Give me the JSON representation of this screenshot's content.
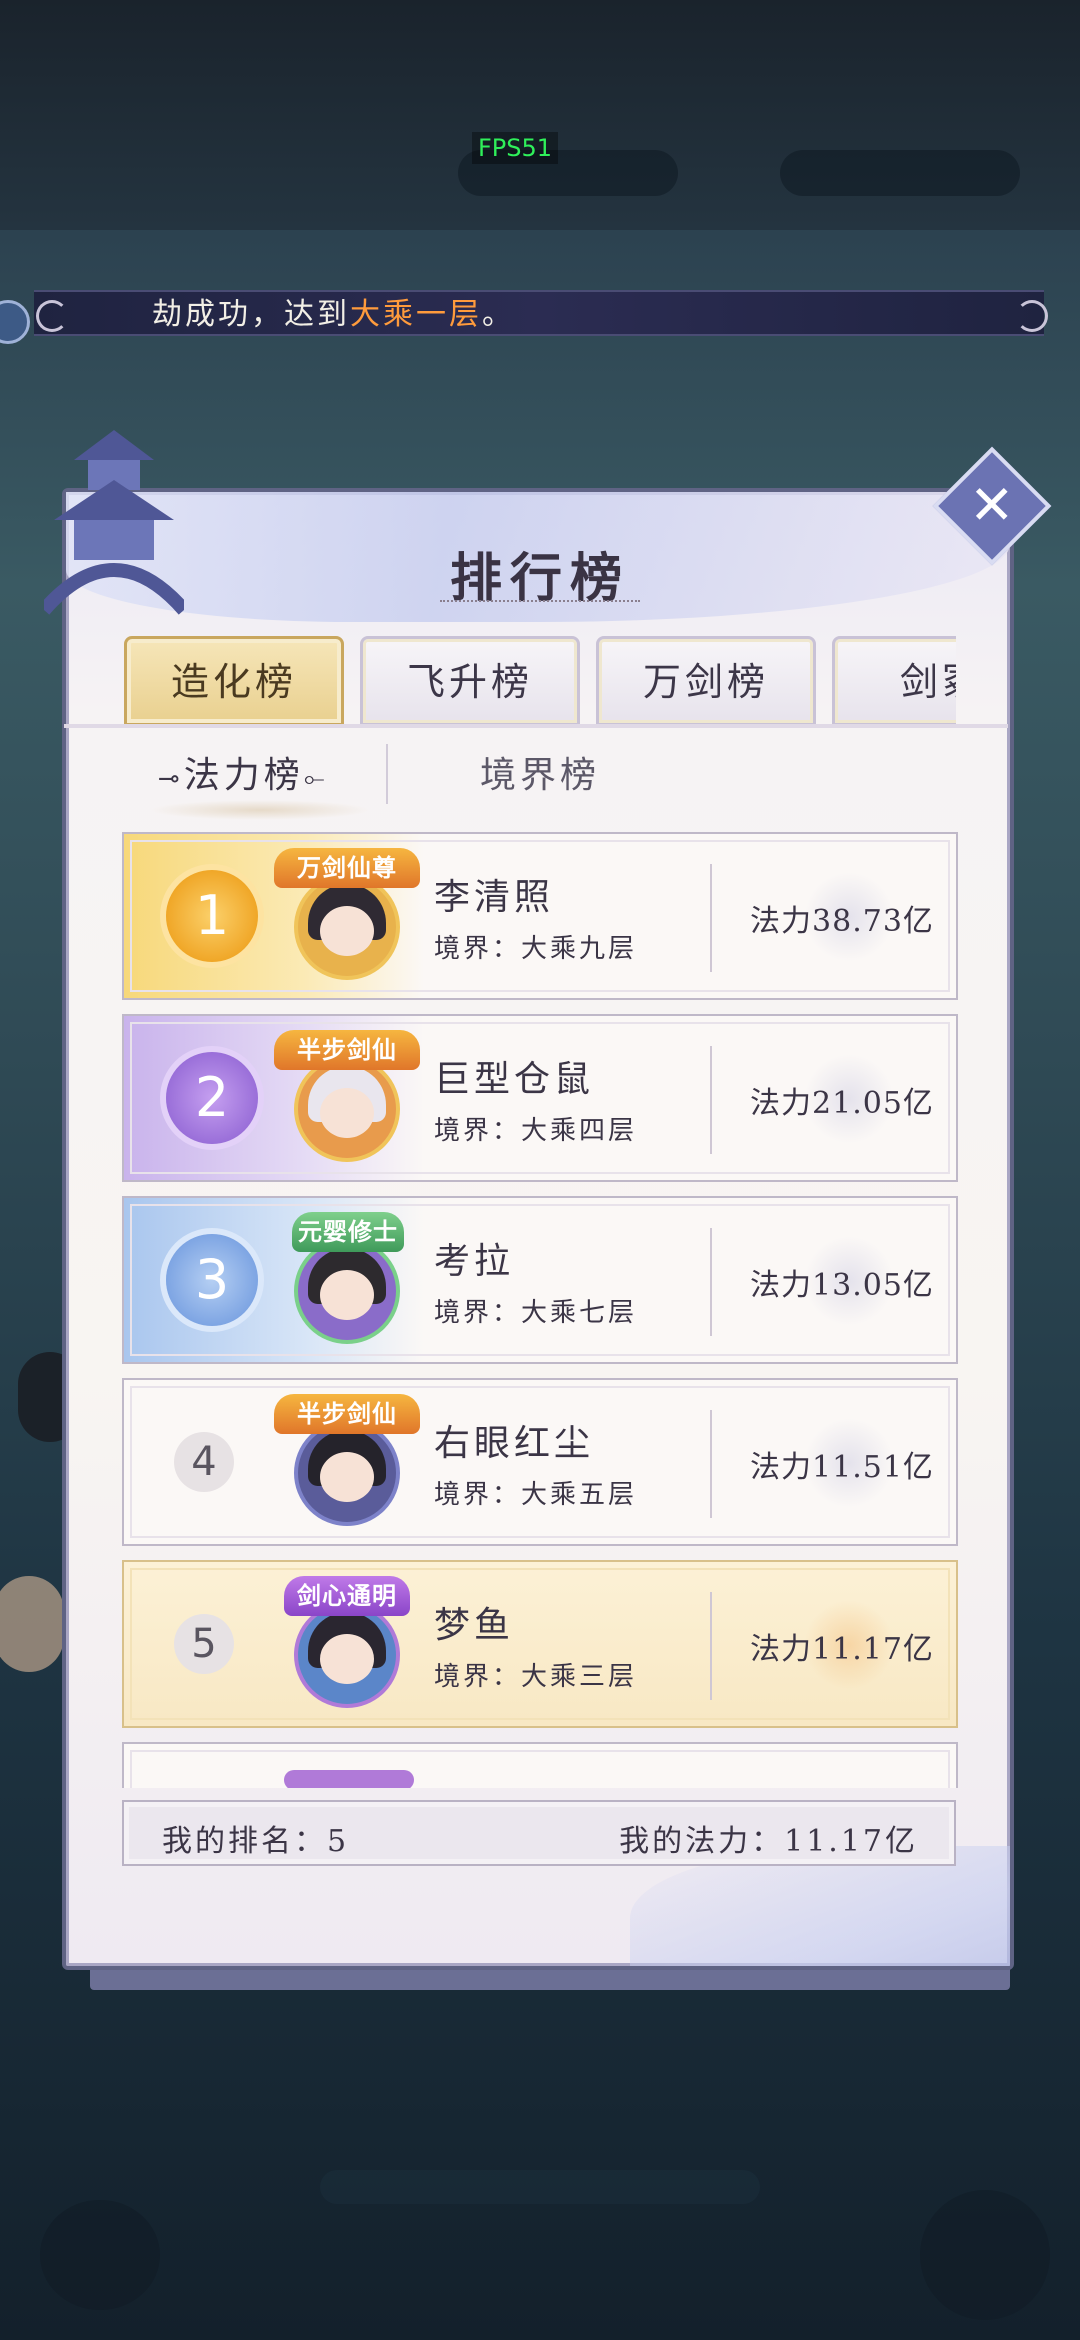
{
  "fps": "FPS51",
  "ticker": {
    "prefix": "劫成功，达到",
    "highlight": "大乘一层",
    "suffix": "。"
  },
  "panel": {
    "title": "排行榜",
    "close_icon": "close-x-icon"
  },
  "tabs": [
    {
      "label": "造化榜",
      "active": true
    },
    {
      "label": "飞升榜",
      "active": false
    },
    {
      "label": "万剑榜",
      "active": false
    },
    {
      "label": "剑冢",
      "active": false
    }
  ],
  "subtabs": {
    "left_orn": "⊸",
    "right_orn": "⟜",
    "active": "法力榜",
    "inactive": "境界榜"
  },
  "ranking": [
    {
      "rank": "1",
      "badge": "万剑仙尊",
      "name": "李清照",
      "realm": "境界：大乘九层",
      "power": "法力38.73亿",
      "style": "gold"
    },
    {
      "rank": "2",
      "badge": "半步剑仙",
      "name": "巨型仓鼠",
      "realm": "境界：大乘四层",
      "power": "法力21.05亿",
      "style": "purple"
    },
    {
      "rank": "3",
      "badge": "元婴修士",
      "name": "考拉",
      "realm": "境界：大乘七层",
      "power": "法力13.05亿",
      "style": "blue"
    },
    {
      "rank": "4",
      "badge": "半步剑仙",
      "name": "右眼红尘",
      "realm": "境界：大乘五层",
      "power": "法力11.51亿",
      "style": "plain"
    },
    {
      "rank": "5",
      "badge": "剑心通明",
      "name": "梦鱼",
      "realm": "境界：大乘三层",
      "power": "法力11.17亿",
      "style": "self"
    }
  ],
  "my_rank": {
    "label": "我的排名：5",
    "power": "我的法力：11.17亿"
  },
  "colors": {
    "gold": "#f0a728",
    "purple": "#9a6fd9",
    "blue": "#7ea5e3",
    "highlight": "#ff9b3c",
    "fps": "#2ff05a"
  }
}
